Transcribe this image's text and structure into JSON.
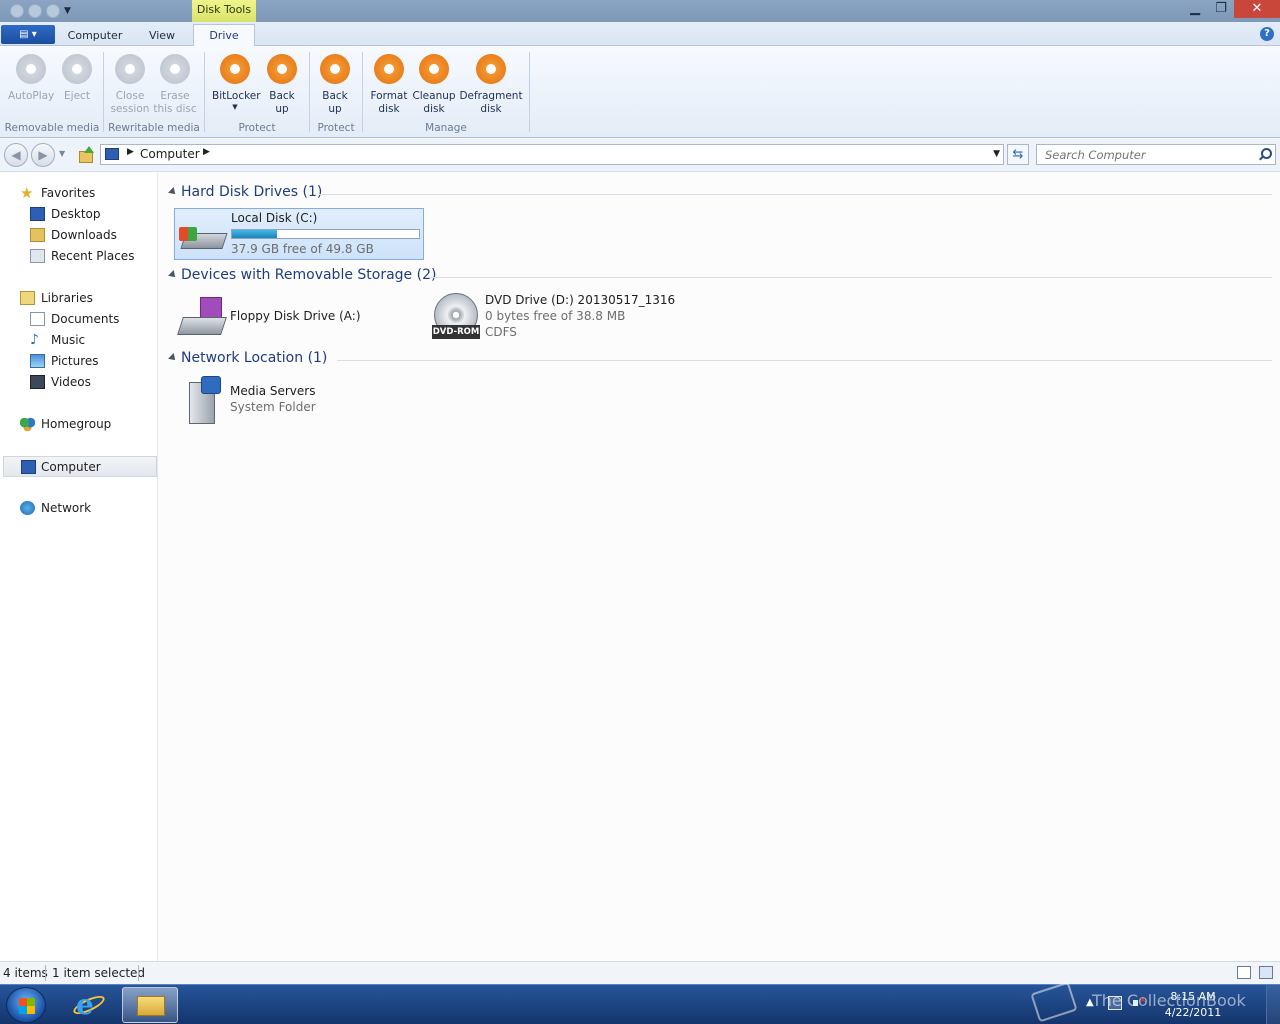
{
  "window": {
    "context_tab": "Disk Tools",
    "minimize": "▁",
    "maximize": "❐",
    "close": "✕"
  },
  "ribbon": {
    "file_label": "▤ ▾",
    "tabs": [
      "Computer",
      "View",
      "Drive"
    ],
    "active_tab": "Drive",
    "help": "?",
    "groups": {
      "removable_media": "Removable media",
      "rewritable_media": "Rewritable media",
      "protect1": "Protect",
      "protect2": "Protect",
      "manage": "Manage"
    },
    "buttons": {
      "autoplay": [
        "AutoPlay"
      ],
      "eject": [
        "Eject"
      ],
      "close_session": [
        "Close",
        "session"
      ],
      "erase_disc": [
        "Erase",
        "this disc"
      ],
      "bitlocker": [
        "BitLocker"
      ],
      "backup1": [
        "Back",
        "up"
      ],
      "backup2": [
        "Back",
        "up"
      ],
      "format": [
        "Format",
        "disk"
      ],
      "cleanup": [
        "Cleanup",
        "disk"
      ],
      "defragment": [
        "Defragment",
        "disk"
      ]
    }
  },
  "address": {
    "path": "Computer",
    "search_placeholder": "Search Computer"
  },
  "nav": {
    "favorites": "Favorites",
    "desktop": "Desktop",
    "downloads": "Downloads",
    "recent": "Recent Places",
    "libraries": "Libraries",
    "documents": "Documents",
    "music": "Music",
    "pictures": "Pictures",
    "videos": "Videos",
    "homegroup": "Homegroup",
    "computer": "Computer",
    "network": "Network"
  },
  "groups": {
    "hdd": "Hard Disk Drives (1)",
    "removable": "Devices with Removable Storage (2)",
    "network": "Network Location (1)"
  },
  "items": {
    "local_disk": {
      "name": "Local Disk (C:)",
      "free": "37.9 GB free of 49.8 GB",
      "used_fraction": 0.239
    },
    "floppy": {
      "name": "Floppy Disk Drive (A:)"
    },
    "dvd": {
      "name": "DVD Drive (D:) 20130517_1316",
      "free": "0 bytes free of 38.8 MB",
      "fs": "CDFS",
      "badge": "DVD-ROM"
    },
    "media": {
      "name": "Media Servers",
      "type": "System Folder"
    }
  },
  "status": {
    "items": "4 items",
    "selected": "1 item selected"
  },
  "taskbar": {
    "time": "8:15 AM",
    "date": "4/22/2011",
    "watermark": "The CollectionBook"
  }
}
